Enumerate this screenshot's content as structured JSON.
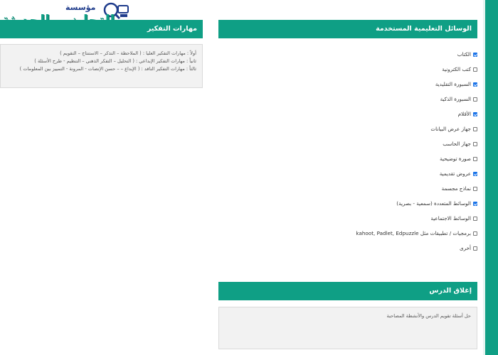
{
  "logo": {
    "main": "التحاضير الحديثة",
    "sub": "مؤسسة"
  },
  "tools_section": {
    "title": "الوسائل التعليمية المستخدمة",
    "items": [
      {
        "label": "الكتاب",
        "checked": true
      },
      {
        "label": "كتب الكترونية",
        "checked": false
      },
      {
        "label": "السبورة التقليدية",
        "checked": true
      },
      {
        "label": "السبورة الذكية",
        "checked": false
      },
      {
        "label": "الأقلام",
        "checked": true
      },
      {
        "label": "جهاز عرض البيانات",
        "checked": false
      },
      {
        "label": "جهاز الحاسب",
        "checked": false
      },
      {
        "label": "صورة توضيحية",
        "checked": false
      },
      {
        "label": "عروض تقديمية",
        "checked": true
      },
      {
        "label": "نماذج مجسمة",
        "checked": false
      },
      {
        "label": "الوسائط المتعددة (سمعية - بصرية)",
        "checked": true
      },
      {
        "label": "الوسائط الاجتماعية",
        "checked": false
      },
      {
        "label": "برمجيات / تطبيقات مثل kahoot, Padlet, Edpuzzle",
        "checked": false
      },
      {
        "label": "أخرى",
        "checked": false
      }
    ]
  },
  "thinking_section": {
    "title": "مهارات التفكير",
    "lines": [
      "أولاً : مهارات التفكير العليا : ( الملاحظة – التذكر – الاستنتاج – التقويم )",
      "ثانياً : مهارات التفكير الإبداعي : ( التحليل – التفكر الذهني – التنظيم - طرح الأسئلة )",
      "ثالثاً : مهارات التفكير الناقد : ( الإبداع – – حسن الإنصات - المرونة - التمييز بين المعلومات )"
    ]
  },
  "closing_section": {
    "title": "إغلاق الدرس",
    "text": "حل أسئلة تقويم الدرس والأنشطة المصاحبة"
  },
  "colors": {
    "accent": "#0f9f85",
    "checkbox_checked": "#1a73e8"
  }
}
